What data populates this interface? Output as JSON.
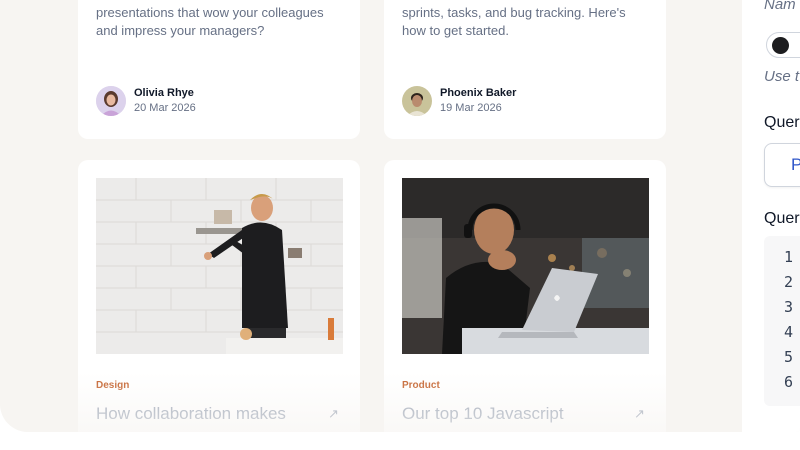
{
  "cards_top": [
    {
      "excerpt": "presentations that wow your colleagues and impress your managers?",
      "author": "Olivia Rhye",
      "date": "20 Mar 2026"
    },
    {
      "excerpt": "sprints, tasks, and bug tracking. Here's how to get started.",
      "author": "Phoenix Baker",
      "date": "19 Mar 2026"
    }
  ],
  "cards_bottom": [
    {
      "category": "Design",
      "title": "How collaboration makes",
      "image": "man-drawing-on-wall-photo"
    },
    {
      "category": "Product",
      "title": "Our top 10 Javascript",
      "image": "man-with-headphones-laptop-photo"
    }
  ],
  "arrow_icon": "↗",
  "side_panel": {
    "name_label": "Nam",
    "hint": "Use t",
    "query_label_1": "Quer",
    "input_value": "P",
    "query_label_2": "Quer",
    "line_numbers": [
      "1",
      "2",
      "3",
      "4",
      "5",
      "6"
    ]
  },
  "colors": {
    "background": "#f7f5f2",
    "accent": "#c4622d",
    "link": "#2f56c9"
  }
}
